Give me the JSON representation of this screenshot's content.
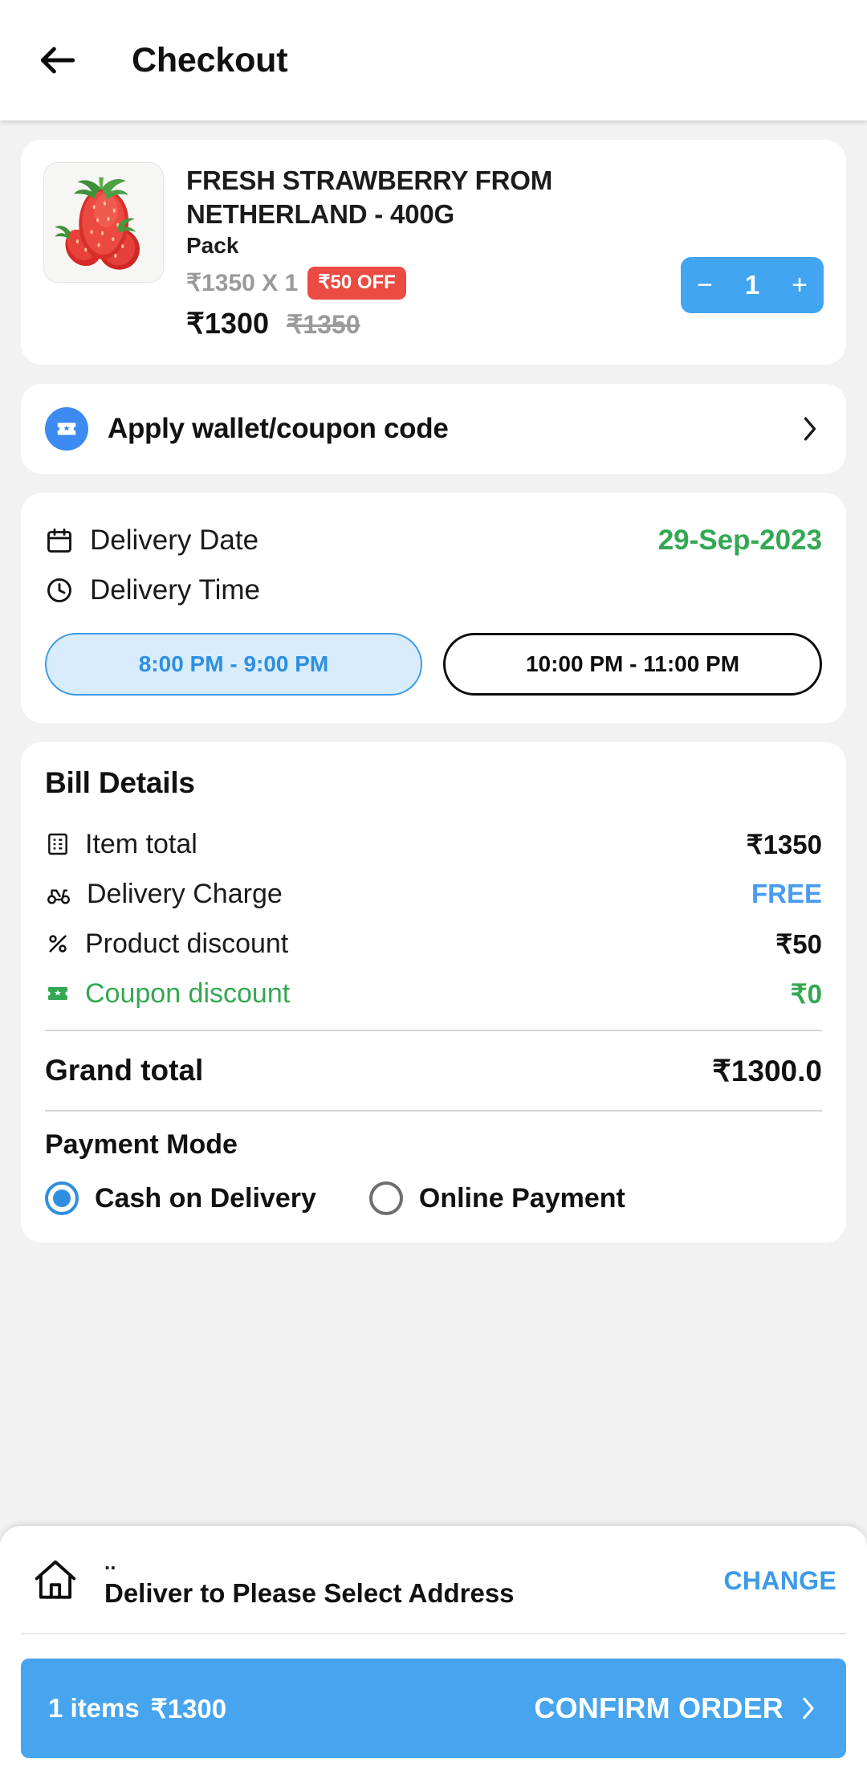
{
  "header": {
    "title": "Checkout",
    "back_icon": "back-arrow-icon"
  },
  "product": {
    "title": "FRESH STRAWBERRY FROM NETHERLAND - 400G",
    "subtitle": "Pack",
    "unit_price_line": "₹1350 X 1",
    "discount_badge": "₹50 OFF",
    "price_now": "₹1300",
    "price_struck": "₹1350",
    "quantity": "1",
    "minus_label": "−",
    "plus_label": "+",
    "image_alt": "strawberries-photo"
  },
  "coupon": {
    "label": "Apply wallet/coupon code",
    "icon": "ticket-icon",
    "chevron": "chevron-right-icon"
  },
  "delivery": {
    "date_label": "Delivery Date",
    "date_value": "29-Sep-2023",
    "time_label": "Delivery Time",
    "slots": [
      {
        "label": "8:00 PM - 9:00 PM",
        "selected": true
      },
      {
        "label": "10:00 PM - 11:00 PM",
        "selected": false
      }
    ]
  },
  "bill": {
    "title": "Bill Details",
    "rows": [
      {
        "icon": "receipt-icon",
        "label": "Item total",
        "value": "₹1350",
        "style": "normal"
      },
      {
        "icon": "scooter-icon",
        "label": "Delivery Charge",
        "value": "FREE",
        "style": "free"
      },
      {
        "icon": "percent-icon",
        "label": "Product discount",
        "value": "₹50",
        "style": "normal"
      },
      {
        "icon": "ticket-green-icon",
        "label": "Coupon discount",
        "value": "₹0",
        "style": "green"
      }
    ],
    "grand_label": "Grand total",
    "grand_value": "₹1300.0",
    "payment_mode_title": "Payment Mode",
    "payment_options": [
      {
        "label": "Cash on Delivery",
        "selected": true
      },
      {
        "label": "Online Payment",
        "selected": false
      }
    ]
  },
  "address": {
    "dots": "..",
    "text": "Deliver to Please Select Address",
    "change_label": "CHANGE",
    "icon": "home-icon"
  },
  "cta": {
    "items_count": "1 items",
    "amount": "₹1300",
    "action_label": "CONFIRM ORDER",
    "arrow": "chevron-right-icon"
  },
  "colors": {
    "accent_blue": "#46a5ee",
    "badge_red": "#ea4b43",
    "green": "#33a852",
    "link_blue": "#3d9ae8"
  }
}
